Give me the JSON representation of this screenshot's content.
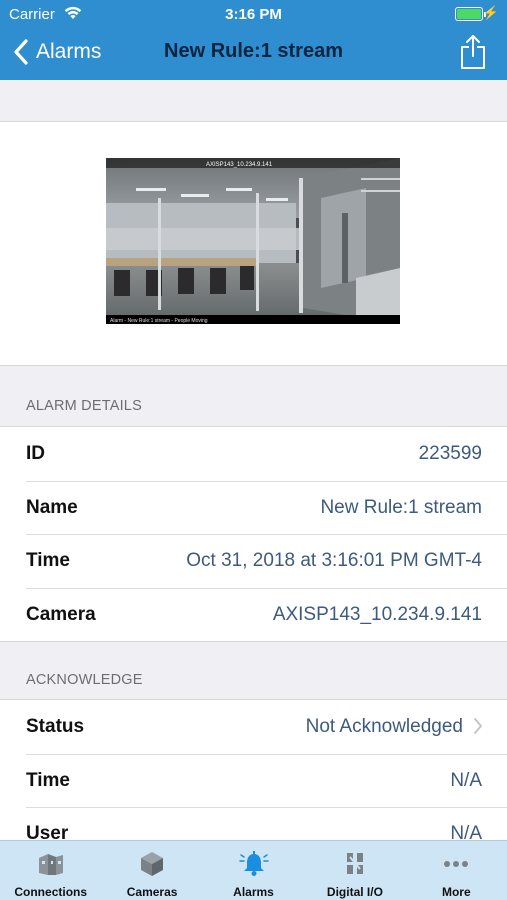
{
  "status_bar": {
    "carrier": "Carrier",
    "time": "3:16 PM"
  },
  "nav": {
    "back_label": "Alarms",
    "title": "New Rule:1 stream"
  },
  "snapshot": {
    "overlay_top": "AXISP143_10.234.9.141",
    "overlay_bottom": "Alarm - New Rule:1 stream - People Moving"
  },
  "alarm_details": {
    "header": "ALARM DETAILS",
    "rows": [
      {
        "label": "ID",
        "value": "223599"
      },
      {
        "label": "Name",
        "value": "New Rule:1 stream"
      },
      {
        "label": "Time",
        "value": "Oct 31, 2018 at 3:16:01 PM GMT-4"
      },
      {
        "label": "Camera",
        "value": "AXISP143_10.234.9.141"
      }
    ]
  },
  "acknowledge": {
    "header": "ACKNOWLEDGE",
    "rows": [
      {
        "label": "Status",
        "value": "Not Acknowledged"
      },
      {
        "label": "Time",
        "value": "N/A"
      },
      {
        "label": "User",
        "value": "N/A"
      }
    ]
  },
  "tabbar": {
    "active": "Alarms",
    "tabs": [
      {
        "label": "Connections",
        "icon": "building-icon"
      },
      {
        "label": "Cameras",
        "icon": "camera-cube-icon"
      },
      {
        "label": "Alarms",
        "icon": "bell-icon"
      },
      {
        "label": "Digital I/O",
        "icon": "digital-io-icon"
      },
      {
        "label": "More",
        "icon": "more-dots-icon"
      }
    ]
  },
  "colors": {
    "nav_bar": "#2f8ecf",
    "nav_title": "#0b2440",
    "value_text": "#3d5a80",
    "tab_bar": "#cde5f5",
    "active_tab": "#1a8fe0",
    "battery": "#4cd964"
  }
}
